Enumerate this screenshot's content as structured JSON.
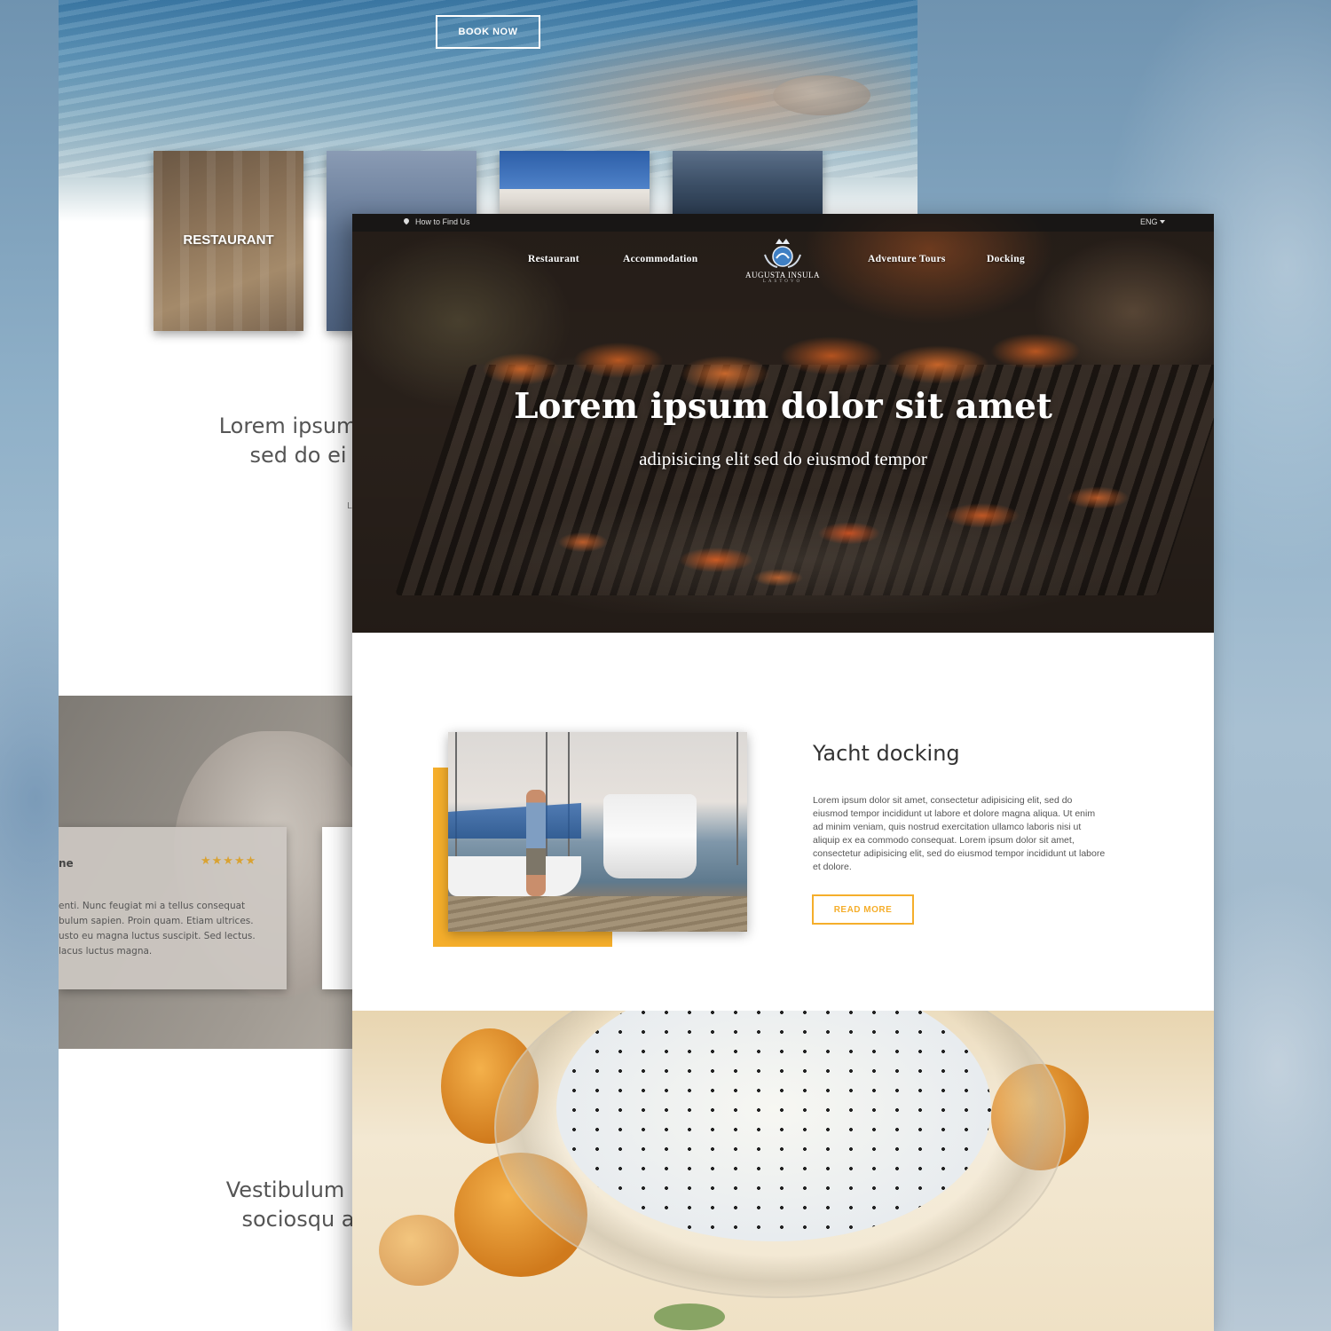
{
  "back_page": {
    "book_now": "BOOK NOW",
    "tiles": [
      {
        "label": "RESTAURANT"
      },
      {
        "label": ""
      },
      {
        "label": ""
      },
      {
        "label": ""
      }
    ],
    "heading_partial": "Lorem ipsum d\nsed do ei",
    "small_text": "L",
    "review": {
      "name_partial": "ne",
      "stars": "★★★★★",
      "text": "enti. Nunc feugiat mi a tellus consequat\nbulum sapien. Proin quam. Etiam ultrices.\nusto eu magna luctus suscipit. Sed lectus.\n lacus luctus magna."
    },
    "heading2_partial": "Vestibulum la\nsociosqu a"
  },
  "front_page": {
    "topbar": {
      "find_us": "How to Find Us",
      "language": "ENG"
    },
    "nav": {
      "restaurant": "Restaurant",
      "accommodation": "Accommodation",
      "adventure_tours": "Adventure Tours",
      "docking": "Docking"
    },
    "logo": {
      "name": "AUGUSTA INSULA",
      "sub": "LASTOVO"
    },
    "hero": {
      "title": "Lorem ipsum dolor sit amet",
      "subtitle": "adipisicing elit sed do eiusmod tempor"
    },
    "feature": {
      "title": "Yacht docking",
      "text": "Lorem ipsum dolor sit amet, consectetur adipisicing elit, sed do eiusmod tempor incididunt ut labore et dolore magna aliqua. Ut enim ad minim veniam, quis nostrud exercitation ullamco laboris  nisi ut aliquip ex ea commodo consequat. Lorem ipsum dolor sit amet, consectetur adipisicing elit, sed do eiusmod tempor incididunt ut labore et dolore.",
      "button": "READ MORE"
    }
  },
  "colors": {
    "accent": "#f5ae2b",
    "star": "#d9a232"
  }
}
